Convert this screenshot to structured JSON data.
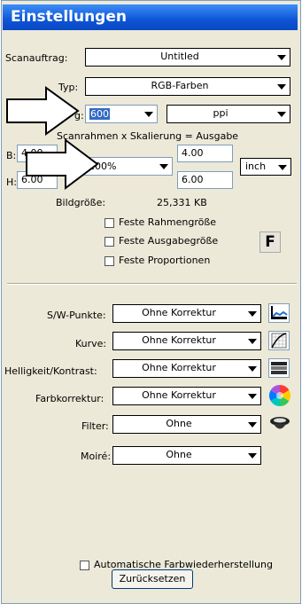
{
  "window": {
    "title": "Einstellungen"
  },
  "scan": {
    "scanauftrag_label": "Scanauftrag:",
    "scanauftrag_value": "Untitled",
    "typ_label": "Typ:",
    "typ_value": "RGB-Farben",
    "aufl_label": "g:",
    "aufl_value": "600",
    "aufl_unit": "ppi",
    "formula": "Scanrahmen x Skalierung = Ausgabe",
    "b_label": "B:",
    "b_value": "4.00",
    "h_label": "H:",
    "h_value": "6.00",
    "scale_value": "100%",
    "out_b": "4.00",
    "out_h": "6.00",
    "unit_value": "inch",
    "bildgroesse_label": "Bildgröße:",
    "bildgroesse_value": "25,331 KB",
    "cb_rahmen": "Feste Rahmengröße",
    "cb_ausgabe": "Feste Ausgabegröße",
    "cb_proportionen": "Feste Proportionen",
    "f_icon_label": "F"
  },
  "corrections": {
    "sw_label": "S/W-Punkte:",
    "sw_value": "Ohne Korrektur",
    "kurve_label": "Kurve:",
    "kurve_value": "Ohne Korrektur",
    "hk_label": "Helligkeit/Kontrast:",
    "hk_value": "Ohne Korrektur",
    "farb_label": "Farbkorrektur:",
    "farb_value": "Ohne Korrektur",
    "filter_label": "Filter:",
    "filter_value": "Ohne",
    "moire_label": "Moiré:",
    "moire_value": "Ohne"
  },
  "footer": {
    "auto_farb": "Automatische Farbwiederherstellung",
    "reset_label": "Zurücksetzen"
  },
  "colors": {
    "title_bg": "#0E55D6",
    "panel_bg": "#ECE9D8",
    "selection": "#316AC5"
  }
}
